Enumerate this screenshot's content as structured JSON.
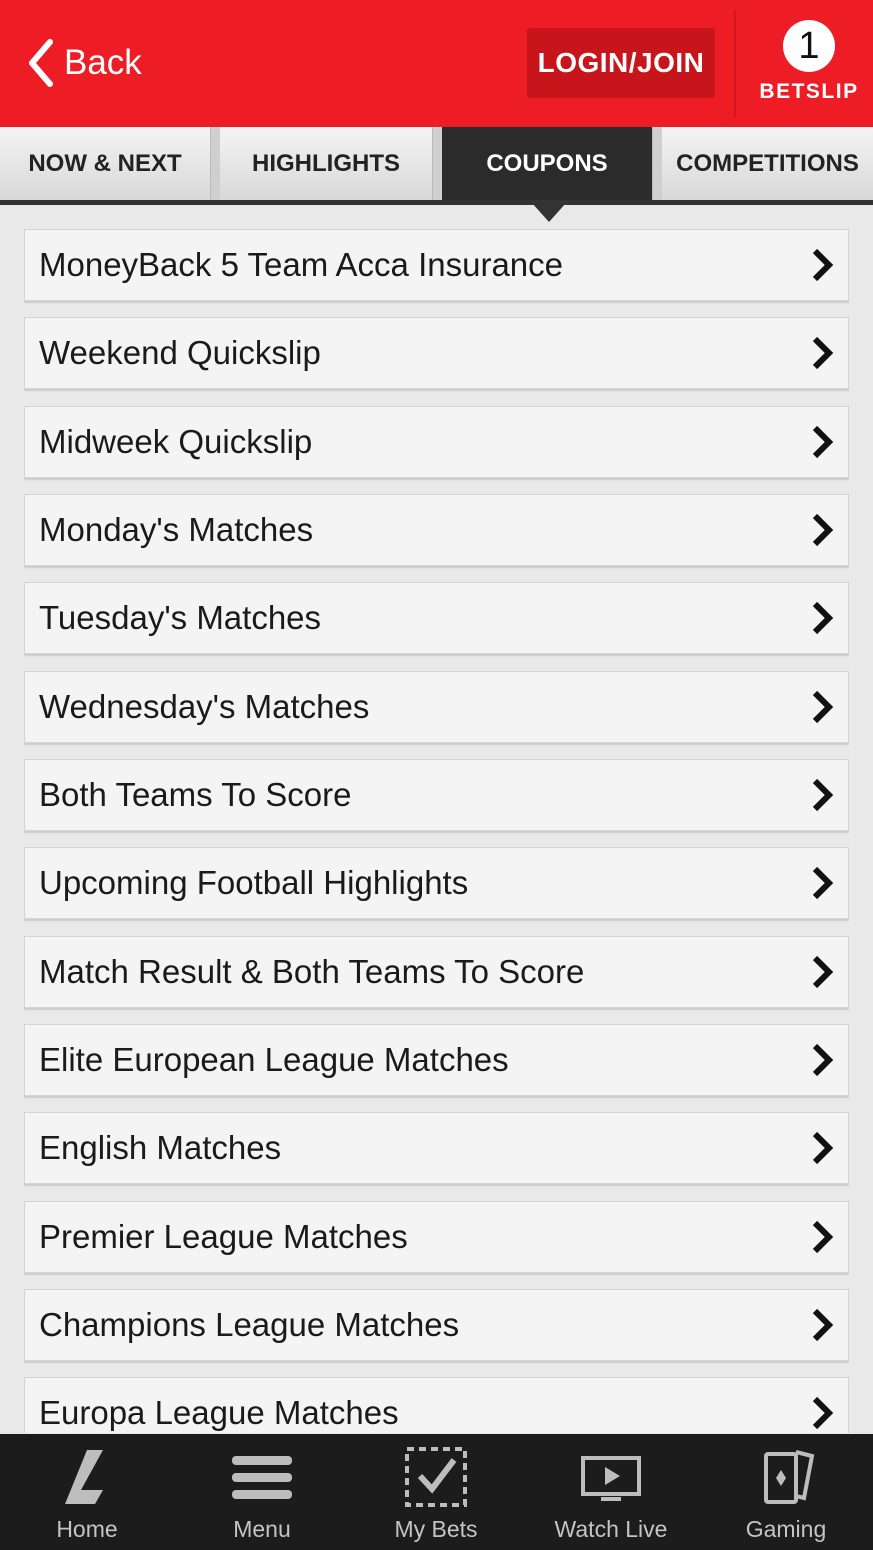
{
  "header": {
    "back_label": "Back",
    "login_label": "LOGIN/JOIN",
    "betslip_count": "1",
    "betslip_label": "BETSLIP"
  },
  "tabs": [
    {
      "label": "NOW & NEXT",
      "active": false
    },
    {
      "label": "HIGHLIGHTS",
      "active": false
    },
    {
      "label": "COUPONS",
      "active": true
    },
    {
      "label": "COMPETITIONS",
      "active": false
    }
  ],
  "coupons": [
    {
      "label": "MoneyBack 5 Team Acca Insurance"
    },
    {
      "label": "Weekend Quickslip"
    },
    {
      "label": "Midweek Quickslip"
    },
    {
      "label": "Monday's Matches"
    },
    {
      "label": "Tuesday's Matches"
    },
    {
      "label": "Wednesday's Matches"
    },
    {
      "label": "Both Teams To Score"
    },
    {
      "label": "Upcoming Football Highlights"
    },
    {
      "label": "Match Result & Both Teams To Score"
    },
    {
      "label": "Elite European League Matches"
    },
    {
      "label": "English Matches"
    },
    {
      "label": "Premier League Matches"
    },
    {
      "label": "Champions League Matches"
    },
    {
      "label": "Europa League Matches"
    }
  ],
  "bottom_nav": [
    {
      "label": "Home",
      "icon": "home-logo-icon"
    },
    {
      "label": "Menu",
      "icon": "menu-icon"
    },
    {
      "label": "My Bets",
      "icon": "my-bets-icon"
    },
    {
      "label": "Watch Live",
      "icon": "watch-live-icon"
    },
    {
      "label": "Gaming",
      "icon": "gaming-icon"
    }
  ],
  "colors": {
    "brand_red": "#ee1c25",
    "login_red": "#c8141b",
    "active_tab": "#2b2b2b",
    "nav_background": "#1c1c1c"
  }
}
